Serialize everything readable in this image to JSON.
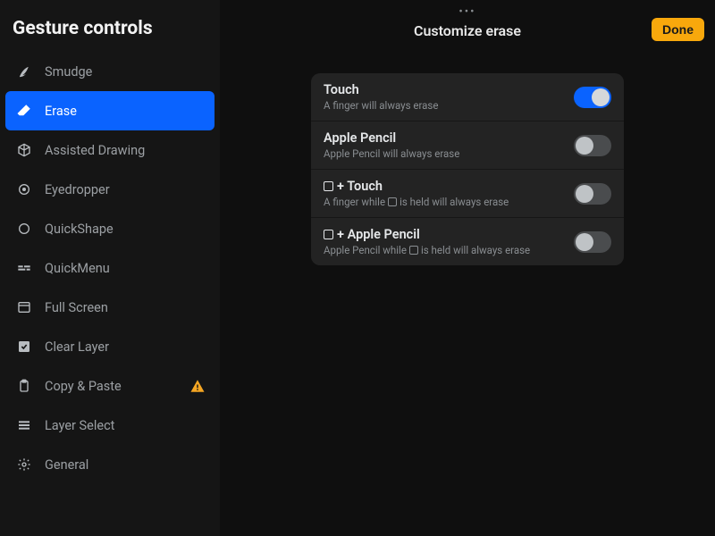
{
  "sidebar": {
    "title": "Gesture controls",
    "items": [
      {
        "label": "Smudge"
      },
      {
        "label": "Erase"
      },
      {
        "label": "Assisted Drawing"
      },
      {
        "label": "Eyedropper"
      },
      {
        "label": "QuickShape"
      },
      {
        "label": "QuickMenu"
      },
      {
        "label": "Full Screen"
      },
      {
        "label": "Clear Layer"
      },
      {
        "label": "Copy & Paste"
      },
      {
        "label": "Layer Select"
      },
      {
        "label": "General"
      }
    ]
  },
  "header": {
    "title": "Customize erase",
    "done": "Done",
    "ellipsis": "•••"
  },
  "options": [
    {
      "title": "Touch",
      "subtitle": "A finger will always erase",
      "enabled": true,
      "squarePrefixTitle": false,
      "squareInSubtitle": false
    },
    {
      "title": "Apple Pencil",
      "subtitle": "Apple Pencil will always erase",
      "enabled": false,
      "squarePrefixTitle": false,
      "squareInSubtitle": false
    },
    {
      "title": "+ Touch",
      "subtitle_pre": "A finger while",
      "subtitle_post": "is held will always erase",
      "enabled": false,
      "squarePrefixTitle": true,
      "squareInSubtitle": true
    },
    {
      "title": "+ Apple Pencil",
      "subtitle_pre": "Apple Pencil while",
      "subtitle_post": "is held will always erase",
      "enabled": false,
      "squarePrefixTitle": true,
      "squareInSubtitle": true
    }
  ]
}
